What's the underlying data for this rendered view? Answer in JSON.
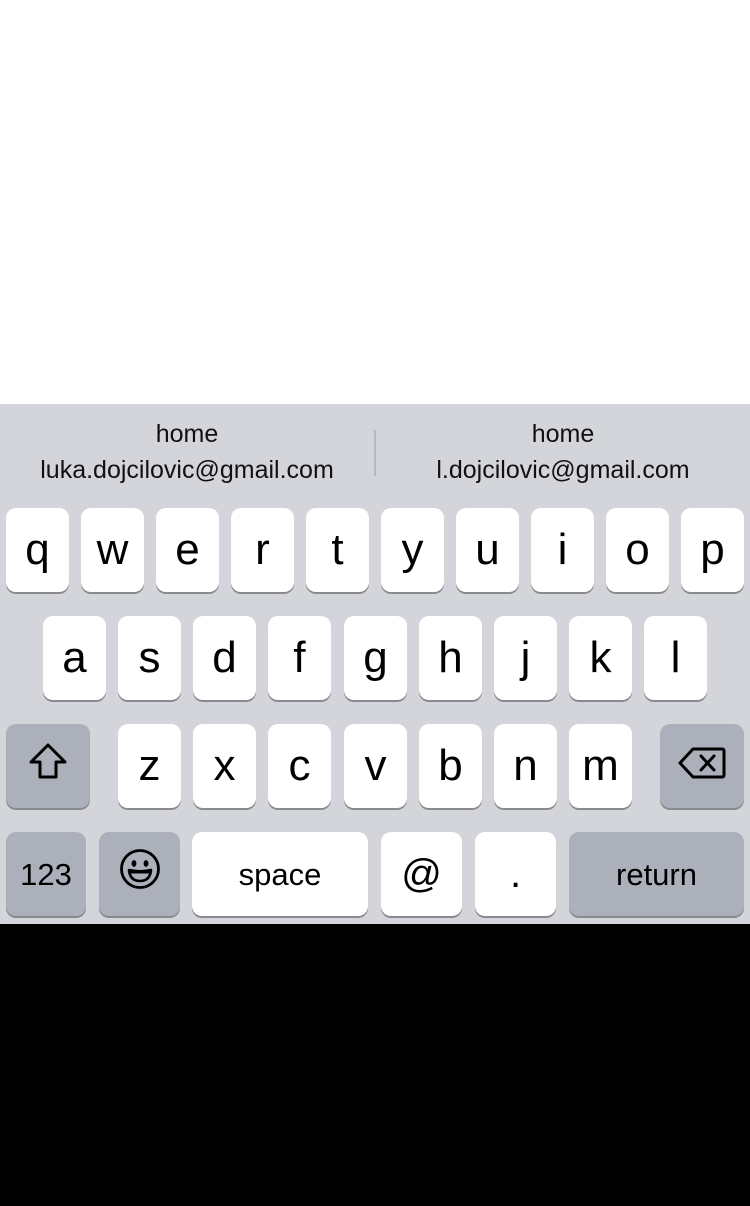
{
  "suggestions": [
    {
      "label": "home",
      "value": "luka.dojcilovic@gmail.com"
    },
    {
      "label": "home",
      "value": "l.dojcilovic@gmail.com"
    }
  ],
  "keyboard": {
    "row1": [
      "q",
      "w",
      "e",
      "r",
      "t",
      "y",
      "u",
      "i",
      "o",
      "p"
    ],
    "row2": [
      "a",
      "s",
      "d",
      "f",
      "g",
      "h",
      "j",
      "k",
      "l"
    ],
    "row3": [
      "z",
      "x",
      "c",
      "v",
      "b",
      "n",
      "m"
    ],
    "numbers_label": "123",
    "space_label": "space",
    "at_label": "@",
    "dot_label": ".",
    "return_label": "return",
    "shift_icon": "shift-icon",
    "backspace_icon": "backspace-icon",
    "emoji_icon": "emoji-icon"
  },
  "colors": {
    "keyboard_bg": "#d4d5da",
    "key_light": "#ffffff",
    "key_dark": "#abb0ba"
  }
}
